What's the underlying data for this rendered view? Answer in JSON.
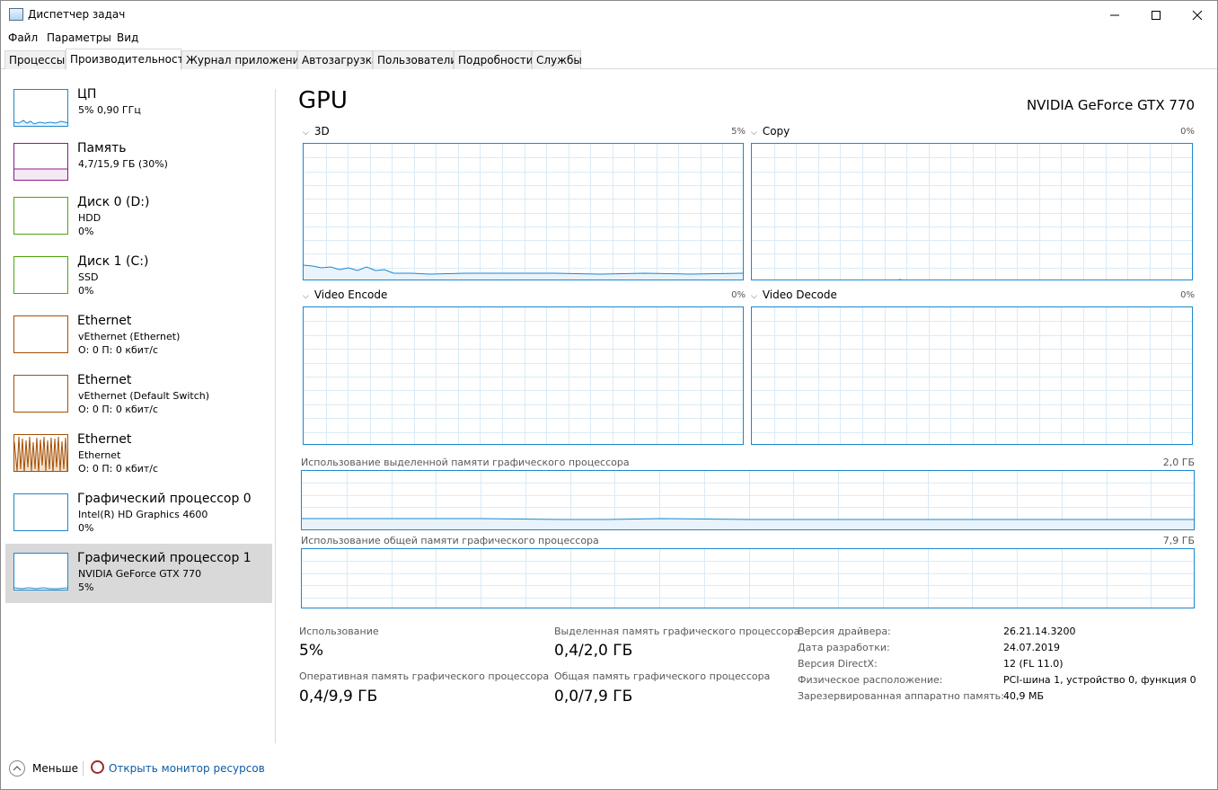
{
  "window": {
    "title": "Диспетчер задач"
  },
  "menu": [
    "Файл",
    "Параметры",
    "Вид"
  ],
  "tabs": [
    "Процессы",
    "Производительность",
    "Журнал приложений",
    "Автозагрузка",
    "Пользователи",
    "Подробности",
    "Службы"
  ],
  "active_tab": 1,
  "sidebar": [
    {
      "name": "ЦП",
      "sub": "5% 0,90 ГГц",
      "sub2": "",
      "color": "#1b88d0"
    },
    {
      "name": "Память",
      "sub": "4,7/15,9 ГБ (30%)",
      "sub2": "",
      "color": "#8b1a8b"
    },
    {
      "name": "Диск 0 (D:)",
      "sub": "HDD",
      "sub2": "0%",
      "color": "#4da60c"
    },
    {
      "name": "Диск 1 (C:)",
      "sub": "SSD",
      "sub2": "0%",
      "color": "#4da60c"
    },
    {
      "name": "Ethernet",
      "sub": "vEthernet (Ethernet)",
      "sub2": "О: 0 П: 0 кбит/с",
      "color": "#a74f01"
    },
    {
      "name": "Ethernet",
      "sub": "vEthernet (Default Switch)",
      "sub2": "О: 0 П: 0 кбит/с",
      "color": "#a74f01"
    },
    {
      "name": "Ethernet",
      "sub": "Ethernet",
      "sub2": "О: 0 П: 0 кбит/с",
      "color": "#a74f01"
    },
    {
      "name": "Графический процессор 0",
      "sub": "Intel(R) HD Graphics 4600",
      "sub2": "0%",
      "color": "#1b88d0"
    },
    {
      "name": "Графический процессор 1",
      "sub": "NVIDIA GeForce GTX 770",
      "sub2": "5%",
      "color": "#1b88d0"
    }
  ],
  "selected_item": 8,
  "main": {
    "title": "GPU",
    "model": "NVIDIA GeForce GTX 770",
    "graphs": [
      {
        "label": "3D",
        "pct": "5%"
      },
      {
        "label": "Copy",
        "pct": "0%"
      },
      {
        "label": "Video Encode",
        "pct": "0%"
      },
      {
        "label": "Video Decode",
        "pct": "0%"
      }
    ],
    "dedicated_mem": {
      "label": "Использование выделенной памяти графического процессора",
      "max": "2,0 ГБ"
    },
    "shared_mem": {
      "label": "Использование общей памяти графического процессора",
      "max": "7,9 ГБ"
    },
    "stats": {
      "usage_label": "Использование",
      "usage_value": "5%",
      "ded_label": "Выделенная память графического процессора",
      "ded_value": "0,4/2,0 ГБ",
      "gpu_mem_label": "Оперативная память графического процессора",
      "gpu_mem_value": "0,4/9,9 ГБ",
      "shared_label": "Общая память графического процессора",
      "shared_value": "0,0/7,9 ГБ"
    },
    "info": [
      {
        "key": "Версия драйвера:",
        "value": "26.21.14.3200"
      },
      {
        "key": "Дата разработки:",
        "value": "24.07.2019"
      },
      {
        "key": "Версия DirectX:",
        "value": "12 (FL 11.0)"
      },
      {
        "key": "Физическое расположение:",
        "value": "PCI-шина 1, устройство 0, функция 0"
      },
      {
        "key": "Зарезервированная аппаратно память:",
        "value": "40,9 МБ"
      }
    ]
  },
  "footer": {
    "less": "Меньше",
    "monitor": "Открыть монитор ресурсов"
  }
}
